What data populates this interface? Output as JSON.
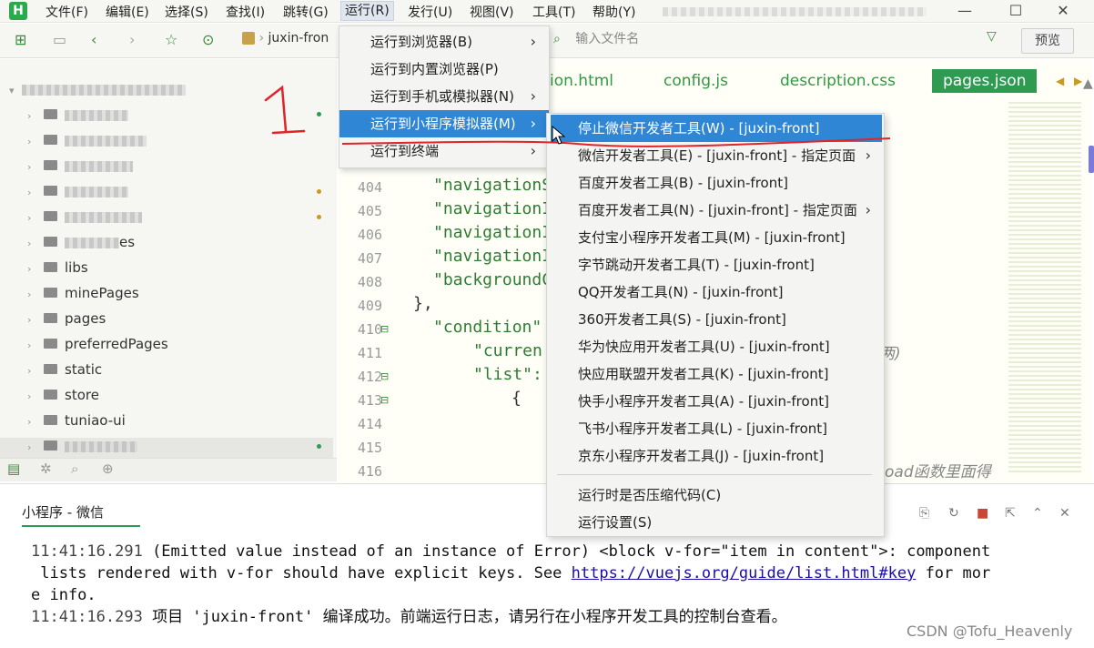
{
  "menubar": {
    "logo": "H",
    "items": [
      "文件(F)",
      "编辑(E)",
      "选择(S)",
      "查找(I)",
      "跳转(G)",
      "运行(R)",
      "发行(U)",
      "视图(V)",
      "工具(T)",
      "帮助(Y)"
    ],
    "window_controls": [
      "—",
      "☐",
      "✕"
    ]
  },
  "toolbar": {
    "project_label": "juxin-fron",
    "search_placeholder": "输入文件名",
    "preview_label": "预览"
  },
  "sidebar": {
    "tree": [
      "es",
      "libs",
      "minePages",
      "pages",
      "preferredPages",
      "static",
      "store",
      "tuniao-ui"
    ]
  },
  "editor": {
    "tabs": [
      "ion.html",
      "config.js",
      "description.css",
      "pages.json"
    ],
    "line_numbers": [
      "404",
      "405",
      "406",
      "407",
      "408",
      "409",
      "410",
      "411",
      "412",
      "413",
      "414",
      "415",
      "416"
    ],
    "code_lines": [
      "\"navigationS",
      "\"navigationI",
      "\"navigationI",
      "\"navigationI",
      "\"backgroundC",
      "},",
      "\"condition\"",
      "\"curren",
      "\"list\":",
      "{"
    ],
    "right_text_1": "两)",
    "right_text_2": "oad函数里面得"
  },
  "run_menu": {
    "items": [
      "运行到浏览器(B)",
      "运行到内置浏览器(P)",
      "运行到手机或模拟器(N)",
      "运行到小程序模拟器(M)",
      "运行到终端"
    ]
  },
  "sub_menu": {
    "items": [
      "停止微信开发者工具(W) - [juxin-front]",
      "微信开发者工具(E) - [juxin-front] - 指定页面",
      "百度开发者工具(B) - [juxin-front]",
      "百度开发者工具(N) - [juxin-front] - 指定页面",
      "支付宝小程序开发者工具(M) - [juxin-front]",
      "字节跳动开发者工具(T) - [juxin-front]",
      "QQ开发者工具(N) - [juxin-front]",
      "360开发者工具(S) - [juxin-front]",
      "华为快应用开发者工具(U) - [juxin-front]",
      "快应用联盟开发者工具(K) - [juxin-front]",
      "快手小程序开发者工具(A) - [juxin-front]",
      "飞书小程序开发者工具(L) - [juxin-front]",
      "京东小程序开发者工具(J) - [juxin-front]",
      "运行时是否压缩代码(C)",
      "运行设置(S)"
    ]
  },
  "annotation": {
    "number": "1"
  },
  "console": {
    "tab_label": "小程序 - 微信",
    "line1_ts": "11:41:16.291",
    "line1_text": " (Emitted value instead of an instance of Error) <block v-for=\"item in content\">: component",
    "line2_text": " lists rendered with v-for should have explicit keys. See ",
    "line2_link": "https://vuejs.org/guide/list.html#key",
    "line2_tail": " for mor",
    "line3_text": "e info.",
    "line4_ts": "11:41:16.293",
    "line4_text": " 项目 'juxin-front' 编译成功。前端运行日志，请另行在小程序开发工具的控制台查看。"
  },
  "watermark": "CSDN @Tofu_Heavenly",
  "colors": {
    "accent": "#2e9a52",
    "highlight": "#2f86d4",
    "annotation": "#e0242a"
  }
}
